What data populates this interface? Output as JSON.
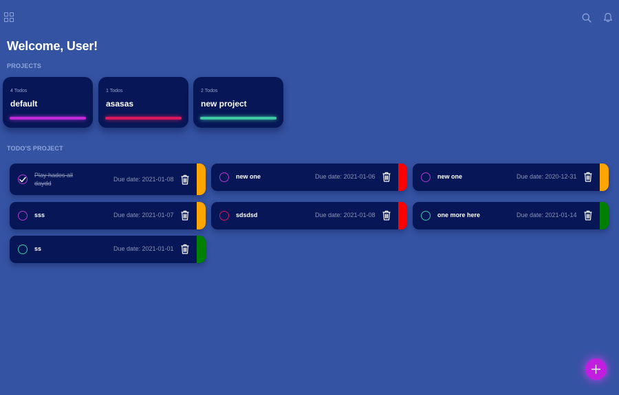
{
  "header": {
    "menu_icon": "grid-icon",
    "search_icon": "search-icon",
    "notification_icon": "bell-icon"
  },
  "welcome": "Welcome, User!",
  "projects_label": "PROJECTS",
  "projects": [
    {
      "count": "4 Todos",
      "name": "default",
      "color": "#c02ad8"
    },
    {
      "count": "1 Todos",
      "name": "asasas",
      "color": "#d9195c"
    },
    {
      "count": "2 Todos",
      "name": "new project",
      "color": "#3ec9a6"
    }
  ],
  "todos_label": "TODO'S PROJECT",
  "todos": [
    {
      "title": "Play hades all daydd",
      "due": "Due date: 2021-01-08",
      "done": true,
      "checkbox_color": "#b43ad0",
      "priority_color": "#ffa500"
    },
    {
      "title": "new one",
      "due": "Due date: 2021-01-06",
      "done": false,
      "checkbox_color": "#b43ad0",
      "priority_color": "#ff0000"
    },
    {
      "title": "new one",
      "due": "Due date: 2020-12-31",
      "done": false,
      "checkbox_color": "#b43ad0",
      "priority_color": "#ffa500"
    },
    {
      "title": "sss",
      "due": "Due date: 2021-01-07",
      "done": false,
      "checkbox_color": "#b43ad0",
      "priority_color": "#ffa500"
    },
    {
      "title": "sdsdsd",
      "due": "Due date: 2021-01-08",
      "done": false,
      "checkbox_color": "#d9195c",
      "priority_color": "#ff0000"
    },
    {
      "title": "one more here",
      "due": "Due date: 2021-01-14",
      "done": false,
      "checkbox_color": "#3ec9a6",
      "priority_color": "#008000"
    },
    {
      "title": "ss",
      "due": "Due date: 2021-01-01",
      "done": false,
      "checkbox_color": "#3ec9a6",
      "priority_color": "#008000"
    }
  ],
  "fab": {
    "icon": "plus-icon",
    "color": "#c11ee0"
  }
}
